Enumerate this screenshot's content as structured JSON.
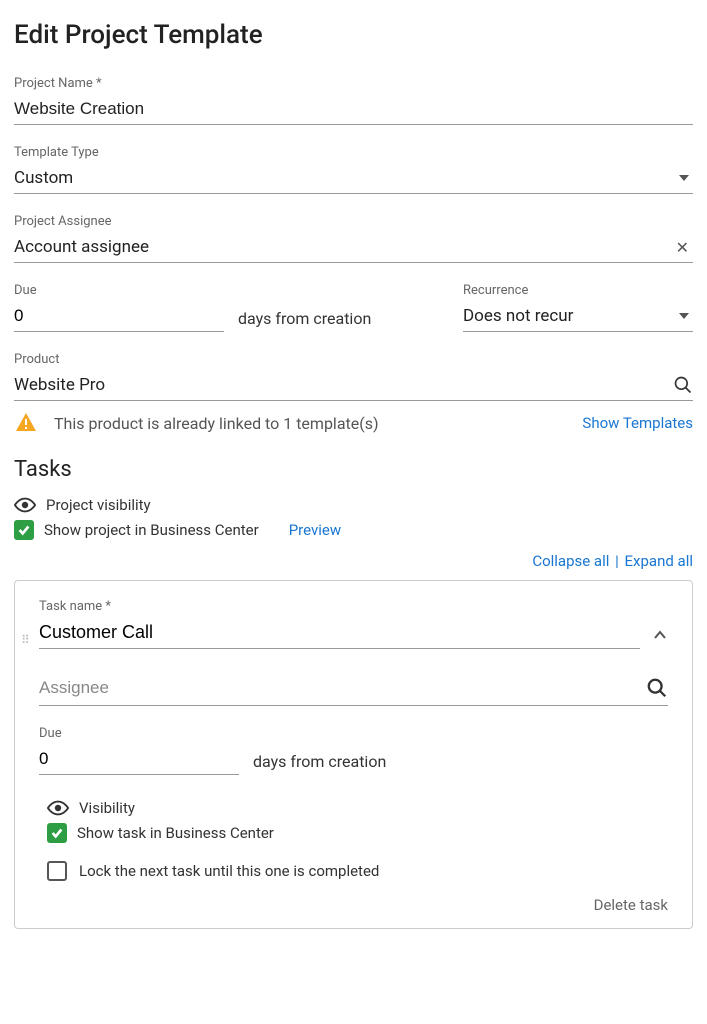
{
  "page": {
    "title": "Edit Project Template"
  },
  "fields": {
    "project_name": {
      "label": "Project Name *",
      "value": "Website Creation"
    },
    "template_type": {
      "label": "Template Type",
      "value": "Custom"
    },
    "project_assignee": {
      "label": "Project Assignee",
      "value": "Account assignee"
    },
    "due": {
      "label": "Due",
      "value": "0",
      "suffix": "days from creation"
    },
    "recurrence": {
      "label": "Recurrence",
      "value": "Does not recur"
    },
    "product": {
      "label": "Product",
      "value": "Website Pro"
    }
  },
  "warning": {
    "text": "This product is already linked to 1 template(s)",
    "action": "Show Templates"
  },
  "tasks_section": {
    "title": "Tasks",
    "visibility_label": "Project visibility",
    "show_project_label": "Show project in Business Center",
    "preview": "Preview",
    "collapse": "Collapse all",
    "expand": "Expand all"
  },
  "task": {
    "name_label": "Task name *",
    "name_value": "Customer Call",
    "assignee_placeholder": "Assignee",
    "due_label": "Due",
    "due_value": "0",
    "due_suffix": "days from creation",
    "visibility_label": "Visibility",
    "show_task_label": "Show task in Business Center",
    "lock_label": "Lock the next task until this one is completed",
    "delete": "Delete task"
  }
}
